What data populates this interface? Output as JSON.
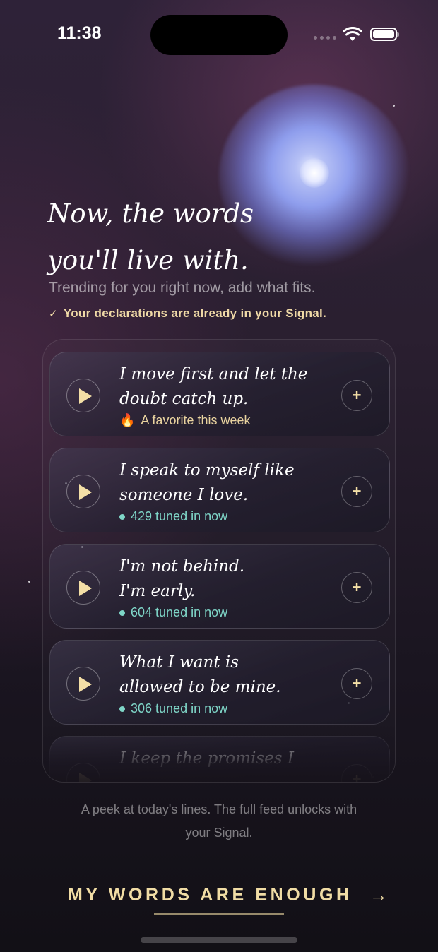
{
  "status_bar": {
    "time": "11:38"
  },
  "hero": {
    "title_line1": "Now, the words",
    "title_line2": "you'll live with.",
    "subtitle": "Trending for you right now, add what fits.",
    "confirmation": "Your declarations are already in your Signal."
  },
  "cards": [
    {
      "line1": "I move first and let the",
      "line2": "doubt catch up.",
      "meta": "A favorite this week",
      "meta_type": "favorite",
      "meta_icon": "flame-icon"
    },
    {
      "line1": "I speak to myself like",
      "line2": "someone I love.",
      "meta": "429 tuned in now",
      "meta_type": "live"
    },
    {
      "line1": "I'm not behind.",
      "line2": "I'm early.",
      "meta": "604 tuned in now",
      "meta_type": "live"
    },
    {
      "line1": "What I want is",
      "line2": "allowed to be mine.",
      "meta": "306 tuned in now",
      "meta_type": "live"
    },
    {
      "line1": "I keep the promises I",
      "line2": "",
      "meta": "",
      "meta_type": "none"
    }
  ],
  "add_label": "+",
  "footer": {
    "peek_line1": "A peek at today's lines. The full feed unlocks with",
    "peek_line2": "your Signal.",
    "cta_label": "MY WORDS ARE ENOUGH",
    "cta_arrow": "→"
  },
  "colors": {
    "accent_gold": "#f0dca4",
    "live_teal": "#7fd6c8",
    "orb_blue": "#8e9ded"
  }
}
